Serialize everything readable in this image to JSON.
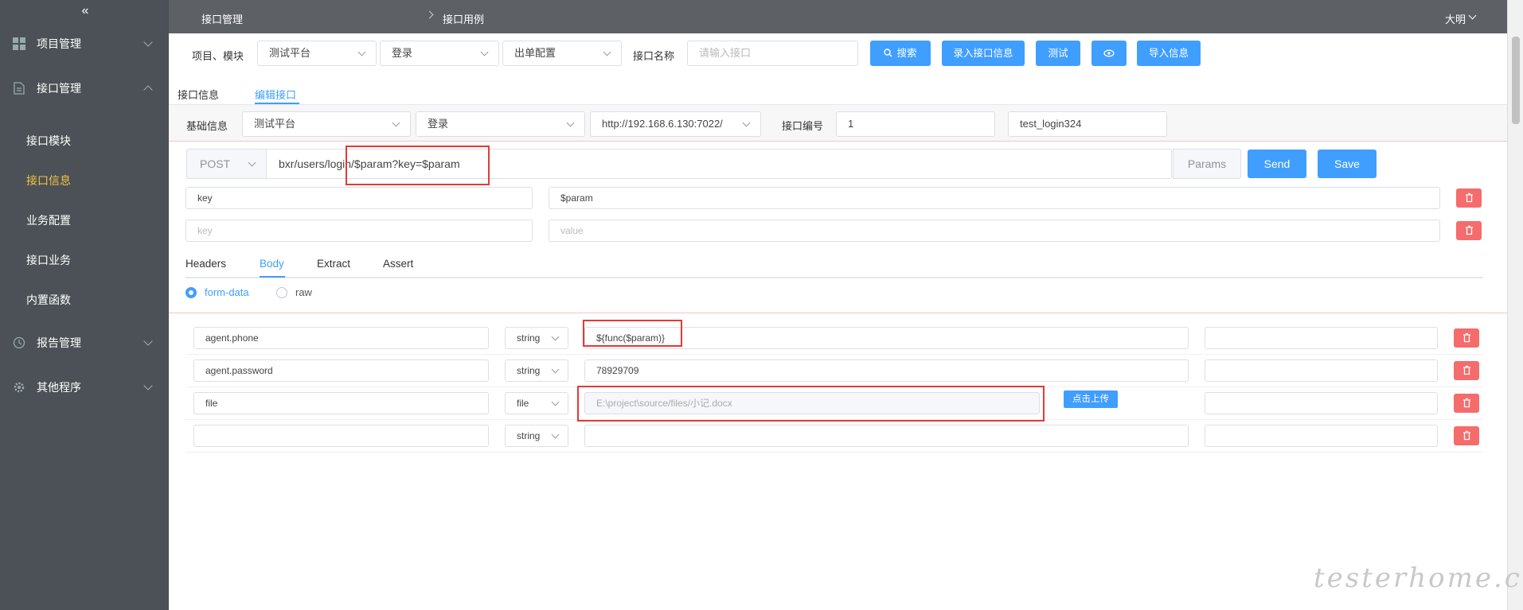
{
  "sidebar": {
    "collapse_icon": "«",
    "groups": [
      {
        "label": "项目管理",
        "icon": "grid-icon"
      },
      {
        "label": "接口管理",
        "icon": "document-icon"
      },
      {
        "label": "报告管理",
        "icon": "clock-icon"
      },
      {
        "label": "其他程序",
        "icon": "gear-icon"
      }
    ],
    "sub_items": [
      "接口模块",
      "接口信息",
      "业务配置",
      "接口业务",
      "内置函数"
    ],
    "active_sub": "接口信息",
    "active_color": "#f5c242"
  },
  "header": {
    "breadcrumb": [
      "接口管理",
      "接口用例"
    ],
    "user": "大明"
  },
  "filters": {
    "project_label": "项目、模块",
    "project": "测试平台",
    "module": "登录",
    "config": "出单配置",
    "name_label": "接口名称",
    "name_placeholder": "请输入接口",
    "buttons": {
      "search": "搜索",
      "add": "录入接口信息",
      "test": "测试",
      "import": "导入信息"
    }
  },
  "tabs": {
    "info": "接口信息",
    "edit": "编辑接口"
  },
  "base": {
    "label": "基础信息",
    "project": "测试平台",
    "module": "登录",
    "host": "http://192.168.6.130:7022/",
    "num_label": "接口编号",
    "num": "1",
    "case_name": "test_login324"
  },
  "request": {
    "method": "POST",
    "url": "bxr/users/login/$param?key=$param",
    "params_label": "Params",
    "send": "Send",
    "save": "Save"
  },
  "params": [
    {
      "key": "key",
      "value": "$param"
    },
    {
      "key_placeholder": "key",
      "value_placeholder": "value"
    }
  ],
  "body_tabs": [
    "Headers",
    "Body",
    "Extract",
    "Assert"
  ],
  "active_body_tab": "Body",
  "body_type": {
    "form": "form-data",
    "raw": "raw"
  },
  "form_rows": [
    {
      "key": "agent.phone",
      "type": "string",
      "value": "${func($param)}",
      "note": ""
    },
    {
      "key": "agent.password",
      "type": "string",
      "value": "78929709",
      "note": ""
    },
    {
      "key": "file",
      "type": "file",
      "value": "E:\\project\\source/files/小记.docx",
      "upload": "点击上传",
      "note": ""
    },
    {
      "key": "",
      "type": "string",
      "value": "",
      "note": ""
    }
  ],
  "watermark": "testerhome.com",
  "colors": {
    "primary": "#409eff",
    "danger": "#f56c6c",
    "highlight": "#e53935",
    "sidebar": "#4b5156"
  }
}
